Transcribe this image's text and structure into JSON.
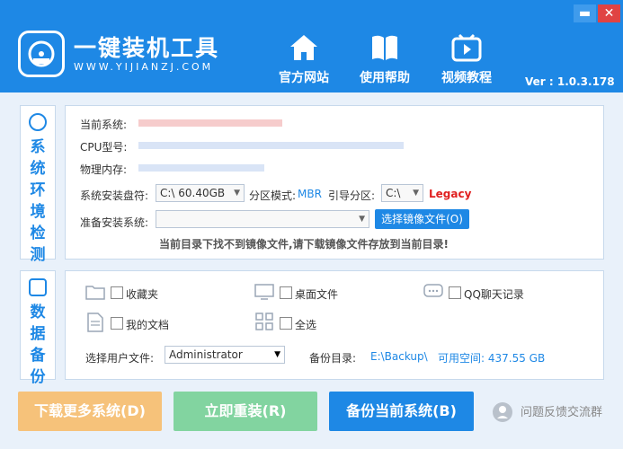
{
  "window": {
    "minimize_glyph": "▬",
    "close_glyph": "✕"
  },
  "brand": {
    "title": "一键装机工具",
    "subtitle": "WWW.YIJIANZJ.COM"
  },
  "nav": [
    {
      "label": "官方网站",
      "icon": "home-icon"
    },
    {
      "label": "使用帮助",
      "icon": "book-icon"
    },
    {
      "label": "视频教程",
      "icon": "video-icon"
    }
  ],
  "version": "Ver : 1.0.3.178",
  "env": {
    "side_label": [
      "系",
      "统",
      "环",
      "境",
      "检",
      "测"
    ],
    "os_label": "当前系统:",
    "cpu_label": "CPU型号:",
    "mem_label": "物理内存:",
    "drive_label": "系统安装盘符:",
    "drive_value": "C:\\   60.40GB",
    "partition_label": "分区模式:",
    "partition_value": "MBR",
    "boot_label": "引导分区:",
    "boot_value": "C:\\",
    "boot_mode": "Legacy",
    "install_label": "准备安装系统:",
    "install_value": "",
    "select_image_button": "选择镜像文件(O)",
    "hint": "当前目录下找不到镜像文件,请下载镜像文件存放到当前目录!"
  },
  "backup": {
    "side_label": [
      "数",
      "据",
      "备",
      "份"
    ],
    "items": [
      {
        "label": "收藏夹"
      },
      {
        "label": "桌面文件"
      },
      {
        "label": "QQ聊天记录"
      },
      {
        "label": "我的文档"
      },
      {
        "label": "全选"
      }
    ],
    "user_label": "选择用户文件:",
    "user_value": "Administrator",
    "dir_label": "备份目录:",
    "dir_value": "E:\\Backup\\",
    "space": "可用空间: 437.55 GB"
  },
  "actions": {
    "download": "下载更多系统(D)",
    "reinstall": "立即重装(R)",
    "backup": "备份当前系统(B)",
    "feedback": "问题反馈交流群"
  },
  "colors": {
    "accent": "#1e88e5",
    "orange": "#f6c27a",
    "green": "#82d4a0",
    "legacy": "#e02020"
  }
}
